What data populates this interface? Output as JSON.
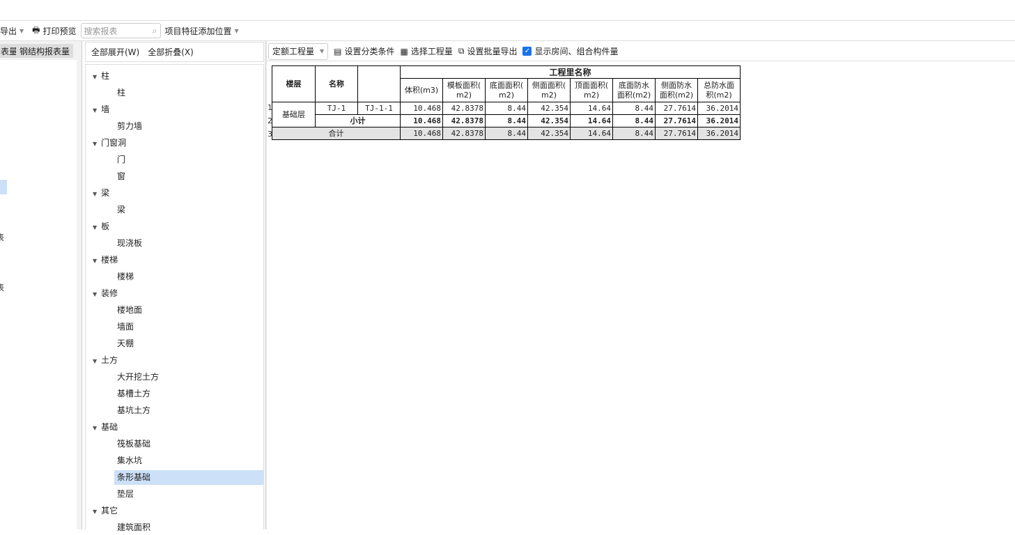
{
  "toolbar": {
    "export": "导出",
    "print_preview": "打印预览",
    "search_placeholder": "搜索报表",
    "feature_position": "项目特征添加位置"
  },
  "left_tabs": [
    "表量",
    "钢结构报表量"
  ],
  "left_list": [
    "表",
    "表"
  ],
  "tree_header": {
    "expand_all": "全部展开(W)",
    "collapse_all": "全部折叠(X)"
  },
  "tree": [
    {
      "label": "柱",
      "children": [
        "柱"
      ]
    },
    {
      "label": "墙",
      "children": [
        "剪力墙"
      ]
    },
    {
      "label": "门窗洞",
      "children": [
        "门",
        "窗"
      ]
    },
    {
      "label": "梁",
      "children": [
        "梁"
      ]
    },
    {
      "label": "板",
      "children": [
        "现浇板"
      ]
    },
    {
      "label": "楼梯",
      "children": [
        "楼梯"
      ]
    },
    {
      "label": "装修",
      "children": [
        "楼地面",
        "墙面",
        "天棚"
      ]
    },
    {
      "label": "土方",
      "children": [
        "大开挖土方",
        "基槽土方",
        "基坑土方"
      ]
    },
    {
      "label": "基础",
      "children": [
        "筏板基础",
        "集水坑",
        "条形基础",
        "垫层"
      ]
    },
    {
      "label": "其它",
      "children": [
        "建筑面积"
      ]
    }
  ],
  "selected_tree_item": "条形基础",
  "right_toolbar": {
    "combo": "定额工程量",
    "set_category": "设置分类条件",
    "select_quantity": "选择工程量",
    "batch_export": "设置批量导出",
    "show_rooms": "显示房间、组合构件量",
    "show_rooms_checked": true
  },
  "table": {
    "h_floor": "楼层",
    "h_name": "名称",
    "h_group": "工程里名称",
    "columns": [
      "体积(m3)",
      "模板面积(m2)",
      "底面面积(m2)",
      "侧面面积(m2)",
      "顶面面积(m2)",
      "底面防水面积(m2)",
      "侧面防水面积(m2)",
      "总防水面积(m2)"
    ],
    "column_lines": [
      [
        "体积(m3)"
      ],
      [
        "模板面积(",
        "m2)"
      ],
      [
        "底面面积(",
        "m2)"
      ],
      [
        "侧面面积(",
        "m2)"
      ],
      [
        "顶面面积(",
        "m2)"
      ],
      [
        "底面防水",
        "面积(m2)"
      ],
      [
        "侧面防水",
        "面积(m2)"
      ],
      [
        "总防水面",
        "积(m2)"
      ]
    ],
    "row_numbers": [
      "1",
      "2",
      "3"
    ],
    "floor": "基础层",
    "name": "TJ-1",
    "sub": "TJ-1-1",
    "row1": [
      "10.468",
      "42.8378",
      "8.44",
      "42.354",
      "14.64",
      "8.44",
      "27.7614",
      "36.2014"
    ],
    "subtotal_label": "小计",
    "subtotal": [
      "10.468",
      "42.8378",
      "8.44",
      "42.354",
      "14.64",
      "8.44",
      "27.7614",
      "36.2014"
    ],
    "total_label": "合计",
    "total": [
      "10.468",
      "42.8378",
      "8.44",
      "42.354",
      "14.64",
      "8.44",
      "27.7614",
      "36.2014"
    ]
  }
}
